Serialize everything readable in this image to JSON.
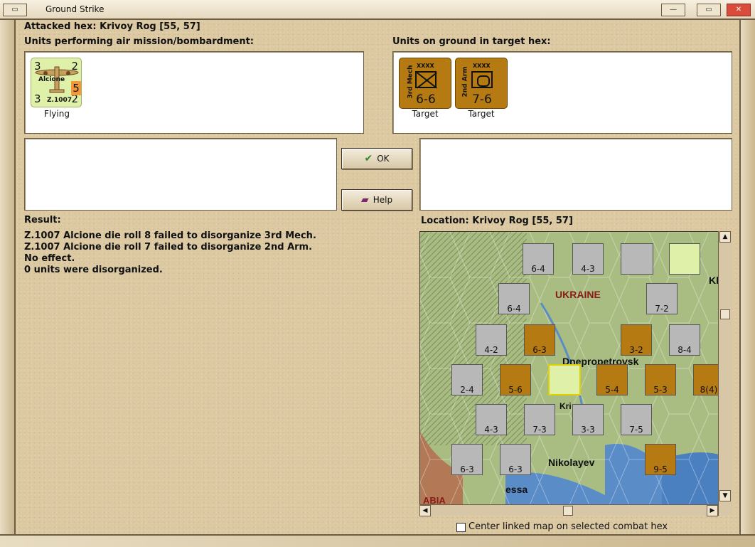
{
  "window": {
    "title": "Ground Strike"
  },
  "attacked_hex": "Attacked hex: Krivoy Rog  [55, 57]",
  "air_units": {
    "label": "Units performing air mission/bombardment:",
    "units": [
      {
        "name": "Alcione",
        "type": "Z.1007",
        "tl": "3",
        "tr": "2",
        "bl": "3",
        "br": "2",
        "strength": "5",
        "status": "Flying"
      }
    ]
  },
  "ground_units": {
    "label": "Units on ground in target hex:",
    "units": [
      {
        "name": "3rd Mech",
        "size": "XXXX",
        "value": "6-6",
        "status": "Target"
      },
      {
        "name": "2nd Arm",
        "size": "XXXX",
        "value": "7-6",
        "status": "Target"
      }
    ]
  },
  "buttons": {
    "ok": "OK",
    "help": "Help"
  },
  "result": {
    "label": "Result:",
    "lines": [
      "Z.1007 Alcione die roll 8 failed to disorganize 3rd Mech.",
      "Z.1007 Alcione die roll 7 failed to disorganize 2nd Arm.",
      "No effect.",
      "0 units were disorganized."
    ]
  },
  "location": {
    "label": "Location:  Krivoy Rog  [55, 57]",
    "map_labels": [
      "UKRAINE",
      "Dnepropetrovsk",
      "Nikolayev",
      "essa",
      "ABIA",
      "Kri",
      "Kh"
    ],
    "map_counters": [
      "6-4",
      "4-3",
      "6-4",
      "7-2",
      "4-2",
      "6-3",
      "3-2",
      "8-4",
      "2-4",
      "5-6",
      "5-4",
      "5-3",
      "8(4)",
      "4-3",
      "7-3",
      "3-3",
      "7-5",
      "6-3",
      "6-3",
      "9-5"
    ]
  },
  "checkbox": {
    "label": "Center linked map on selected combat hex",
    "checked": false
  },
  "colors": {
    "panel_bg": "#dcc9a2",
    "counter_gray": "#b8b8b8",
    "counter_orange": "#b57a12",
    "counter_air": "#dff0a8"
  }
}
